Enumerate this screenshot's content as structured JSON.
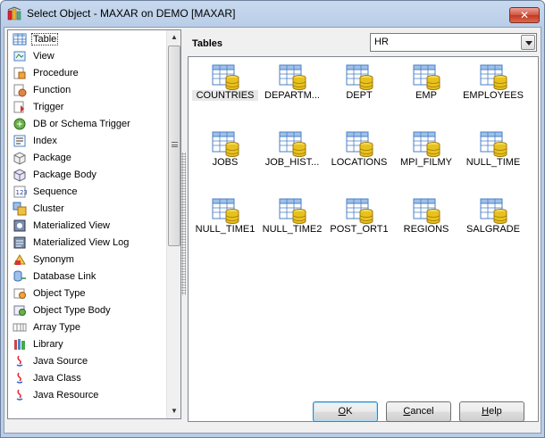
{
  "window": {
    "title": "Select Object - MAXAR on DEMO [MAXAR]",
    "close_label": "✕"
  },
  "object_types": [
    {
      "label": "Table",
      "icon": "table-icon",
      "selected": true
    },
    {
      "label": "View",
      "icon": "view-icon"
    },
    {
      "label": "Procedure",
      "icon": "procedure-icon"
    },
    {
      "label": "Function",
      "icon": "function-icon"
    },
    {
      "label": "Trigger",
      "icon": "trigger-icon"
    },
    {
      "label": "DB or Schema Trigger",
      "icon": "schema-trigger-icon"
    },
    {
      "label": "Index",
      "icon": "index-icon"
    },
    {
      "label": "Package",
      "icon": "package-icon"
    },
    {
      "label": "Package Body",
      "icon": "package-body-icon"
    },
    {
      "label": "Sequence",
      "icon": "sequence-icon"
    },
    {
      "label": "Cluster",
      "icon": "cluster-icon"
    },
    {
      "label": "Materialized View",
      "icon": "materialized-view-icon"
    },
    {
      "label": "Materialized View Log",
      "icon": "materialized-view-log-icon"
    },
    {
      "label": "Synonym",
      "icon": "synonym-icon"
    },
    {
      "label": "Database Link",
      "icon": "database-link-icon"
    },
    {
      "label": "Object Type",
      "icon": "object-type-icon"
    },
    {
      "label": "Object Type Body",
      "icon": "object-type-body-icon"
    },
    {
      "label": "Array Type",
      "icon": "array-type-icon"
    },
    {
      "label": "Library",
      "icon": "library-icon"
    },
    {
      "label": "Java Source",
      "icon": "java-source-icon"
    },
    {
      "label": "Java Class",
      "icon": "java-class-icon"
    },
    {
      "label": "Java Resource",
      "icon": "java-resource-icon"
    }
  ],
  "objects_panel": {
    "heading": "Tables",
    "schema": {
      "selected": "HR"
    },
    "items": [
      {
        "label": "COUNTRIES",
        "selected": true
      },
      {
        "label": "DEPARTM..."
      },
      {
        "label": "DEPT"
      },
      {
        "label": "EMP"
      },
      {
        "label": "EMPLOYEES"
      },
      {
        "label": "JOBS"
      },
      {
        "label": "JOB_HIST..."
      },
      {
        "label": "LOCATIONS"
      },
      {
        "label": "MPI_FILMY"
      },
      {
        "label": "NULL_TIME"
      },
      {
        "label": "NULL_TIME1"
      },
      {
        "label": "NULL_TIME2"
      },
      {
        "label": "POST_ORT1"
      },
      {
        "label": "REGIONS"
      },
      {
        "label": "SALGRADE"
      }
    ]
  },
  "buttons": {
    "ok": {
      "mnemonic": "O",
      "rest": "K"
    },
    "cancel": {
      "mnemonic": "C",
      "rest": "ancel"
    },
    "help": {
      "mnemonic": "H",
      "rest": "elp"
    }
  },
  "colors": {
    "table_grid": "#4a7fc4",
    "table_header": "#9fc0ea",
    "db_cylinder": "#e8c21c"
  }
}
